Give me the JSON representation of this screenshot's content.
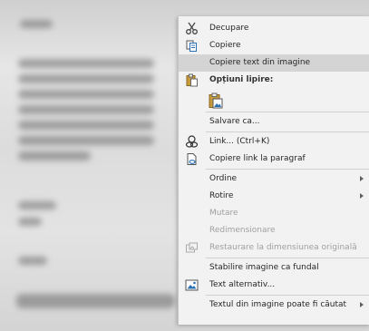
{
  "menu": {
    "items": [
      {
        "label": "Decupare",
        "icon": "scissors-icon",
        "state": "normal",
        "arrow": false
      },
      {
        "label": "Copiere",
        "icon": "copy-icon",
        "state": "normal",
        "arrow": false
      },
      {
        "label": "Copiere text din imagine",
        "icon": "",
        "state": "highlighted",
        "arrow": false
      },
      {
        "label": "Opțiuni lipire:",
        "icon": "paste-icon",
        "state": "header",
        "arrow": false
      },
      {
        "label": "",
        "icon": "paste-picture-icon",
        "state": "bigicon",
        "arrow": false
      },
      {
        "label": "Salvare ca...",
        "icon": "",
        "state": "normal",
        "arrow": false
      },
      {
        "label": "Link... (Ctrl+K)",
        "icon": "link-icon",
        "state": "normal",
        "arrow": false
      },
      {
        "label": "Copiere link la paragraf",
        "icon": "link-paragraph-icon",
        "state": "normal",
        "arrow": false
      },
      {
        "label": "Ordine",
        "icon": "",
        "state": "normal",
        "arrow": true
      },
      {
        "label": "Rotire",
        "icon": "",
        "state": "normal",
        "arrow": true
      },
      {
        "label": "Mutare",
        "icon": "",
        "state": "disabled",
        "arrow": false
      },
      {
        "label": "Redimensionare",
        "icon": "",
        "state": "disabled",
        "arrow": false
      },
      {
        "label": "Restaurare la dimensiunea originală",
        "icon": "restore-size-icon",
        "state": "disabled",
        "arrow": false
      },
      {
        "label": "Stabilire imagine ca fundal",
        "icon": "",
        "state": "normal",
        "arrow": false
      },
      {
        "label": "Text alternativ...",
        "icon": "alt-text-icon",
        "state": "normal",
        "arrow": false
      },
      {
        "label": "Textul din imagine poate fi căutat",
        "icon": "",
        "state": "normal",
        "arrow": true
      }
    ]
  }
}
